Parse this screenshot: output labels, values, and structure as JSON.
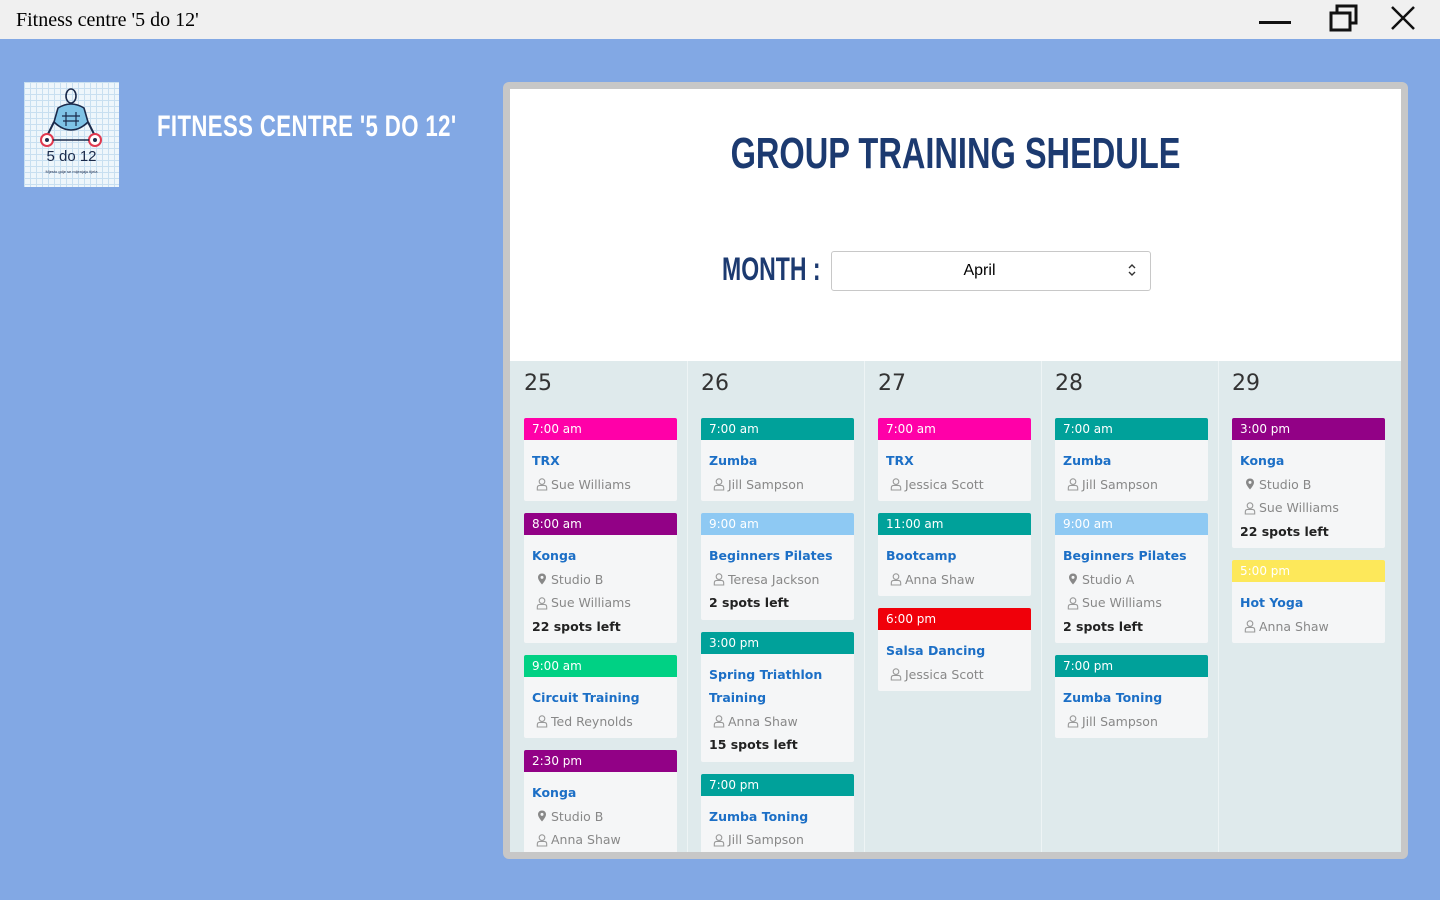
{
  "window": {
    "title": "Fitness centre '5 do 12'"
  },
  "brand": {
    "logo_text": "5 do 12",
    "logo_tagline": "Mjesto gdje se mijenjaju tijela",
    "app_name": "FITNESS CENTRE '5 DO 12'"
  },
  "schedule": {
    "title": "GROUP TRAINING SHEDULE",
    "month_label": "MONTH :",
    "month_value": "April",
    "days": [
      {
        "day": "25",
        "classes": [
          {
            "time": "7:00 am",
            "color": "#ff00a8",
            "name": "TRX",
            "studio": "",
            "instructor": "Sue Williams",
            "spots": ""
          },
          {
            "time": "8:00 am",
            "color": "#920186",
            "name": "Konga",
            "studio": "Studio B",
            "instructor": "Sue Williams",
            "spots": "22 spots left"
          },
          {
            "time": "9:00 am",
            "color": "#00d184",
            "name": "Circuit Training",
            "studio": "",
            "instructor": "Ted Reynolds",
            "spots": ""
          },
          {
            "time": "2:30 pm",
            "color": "#920186",
            "name": "Konga",
            "studio": "Studio B",
            "instructor": "Anna Shaw",
            "spots": ""
          }
        ]
      },
      {
        "day": "26",
        "classes": [
          {
            "time": "7:00 am",
            "color": "#00a19a",
            "name": "Zumba",
            "studio": "",
            "instructor": "Jill Sampson",
            "spots": ""
          },
          {
            "time": "9:00 am",
            "color": "#8ec9f3",
            "name": "Beginners Pilates",
            "studio": "",
            "instructor": "Teresa Jackson",
            "spots": "2 spots left"
          },
          {
            "time": "3:00 pm",
            "color": "#00a19a",
            "name": "Spring Triathlon Training",
            "studio": "",
            "instructor": "Anna Shaw",
            "spots": "15 spots left"
          },
          {
            "time": "7:00 pm",
            "color": "#00a19a",
            "name": "Zumba Toning",
            "studio": "",
            "instructor": "Jill Sampson",
            "spots": ""
          }
        ]
      },
      {
        "day": "27",
        "classes": [
          {
            "time": "7:00 am",
            "color": "#ff00a8",
            "name": "TRX",
            "studio": "",
            "instructor": "Jessica Scott",
            "spots": ""
          },
          {
            "time": "11:00 am",
            "color": "#00a19a",
            "name": "Bootcamp",
            "studio": "",
            "instructor": "Anna Shaw",
            "spots": ""
          },
          {
            "time": "6:00 pm",
            "color": "#f0000a",
            "name": "Salsa Dancing",
            "studio": "",
            "instructor": "Jessica Scott",
            "spots": ""
          }
        ]
      },
      {
        "day": "28",
        "classes": [
          {
            "time": "7:00 am",
            "color": "#00a19a",
            "name": "Zumba",
            "studio": "",
            "instructor": "Jill Sampson",
            "spots": ""
          },
          {
            "time": "9:00 am",
            "color": "#8ec9f3",
            "name": "Beginners Pilates",
            "studio": "Studio A",
            "instructor": "Sue Williams",
            "spots": "2 spots left"
          },
          {
            "time": "7:00 pm",
            "color": "#00a19a",
            "name": "Zumba Toning",
            "studio": "",
            "instructor": "Jill Sampson",
            "spots": ""
          }
        ]
      },
      {
        "day": "29",
        "classes": [
          {
            "time": "3:00 pm",
            "color": "#920186",
            "name": "Konga",
            "studio": "Studio B",
            "instructor": "Sue Williams",
            "spots": "22 spots left"
          },
          {
            "time": "5:00 pm",
            "color": "#fde85a",
            "name": "Hot Yoga",
            "studio": "",
            "instructor": "Anna Shaw",
            "spots": ""
          }
        ]
      }
    ]
  }
}
